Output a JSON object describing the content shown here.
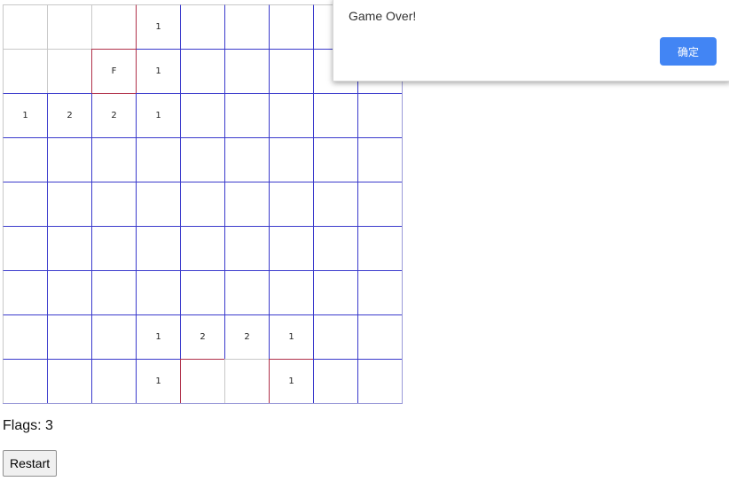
{
  "game": {
    "rows": 9,
    "cols": 9,
    "grid": [
      [
        "",
        "",
        "",
        "1",
        "",
        "",
        "",
        "",
        ""
      ],
      [
        "",
        "",
        "F",
        "1",
        "",
        "",
        "",
        "",
        ""
      ],
      [
        "1",
        "2",
        "2",
        "1",
        "",
        "",
        "",
        "",
        ""
      ],
      [
        "",
        "",
        "",
        "",
        "",
        "",
        "",
        "",
        ""
      ],
      [
        "",
        "",
        "",
        "",
        "",
        "",
        "",
        "",
        ""
      ],
      [
        "",
        "",
        "",
        "",
        "",
        "",
        "",
        "",
        ""
      ],
      [
        "",
        "",
        "",
        "",
        "",
        "",
        "",
        "",
        ""
      ],
      [
        "",
        "",
        "",
        "1",
        "2",
        "2",
        "1",
        "",
        ""
      ],
      [
        "",
        "",
        "",
        "1",
        "",
        "",
        "1",
        "",
        ""
      ]
    ]
  },
  "status": {
    "flags_label": "Flags:",
    "flags_count": "3"
  },
  "controls": {
    "restart_label": "Restart"
  },
  "dialog": {
    "message": "Game Over!",
    "ok_label": "确定"
  },
  "colors": {
    "grid_line": "#3a3acc",
    "accent_button": "#4285f4"
  }
}
